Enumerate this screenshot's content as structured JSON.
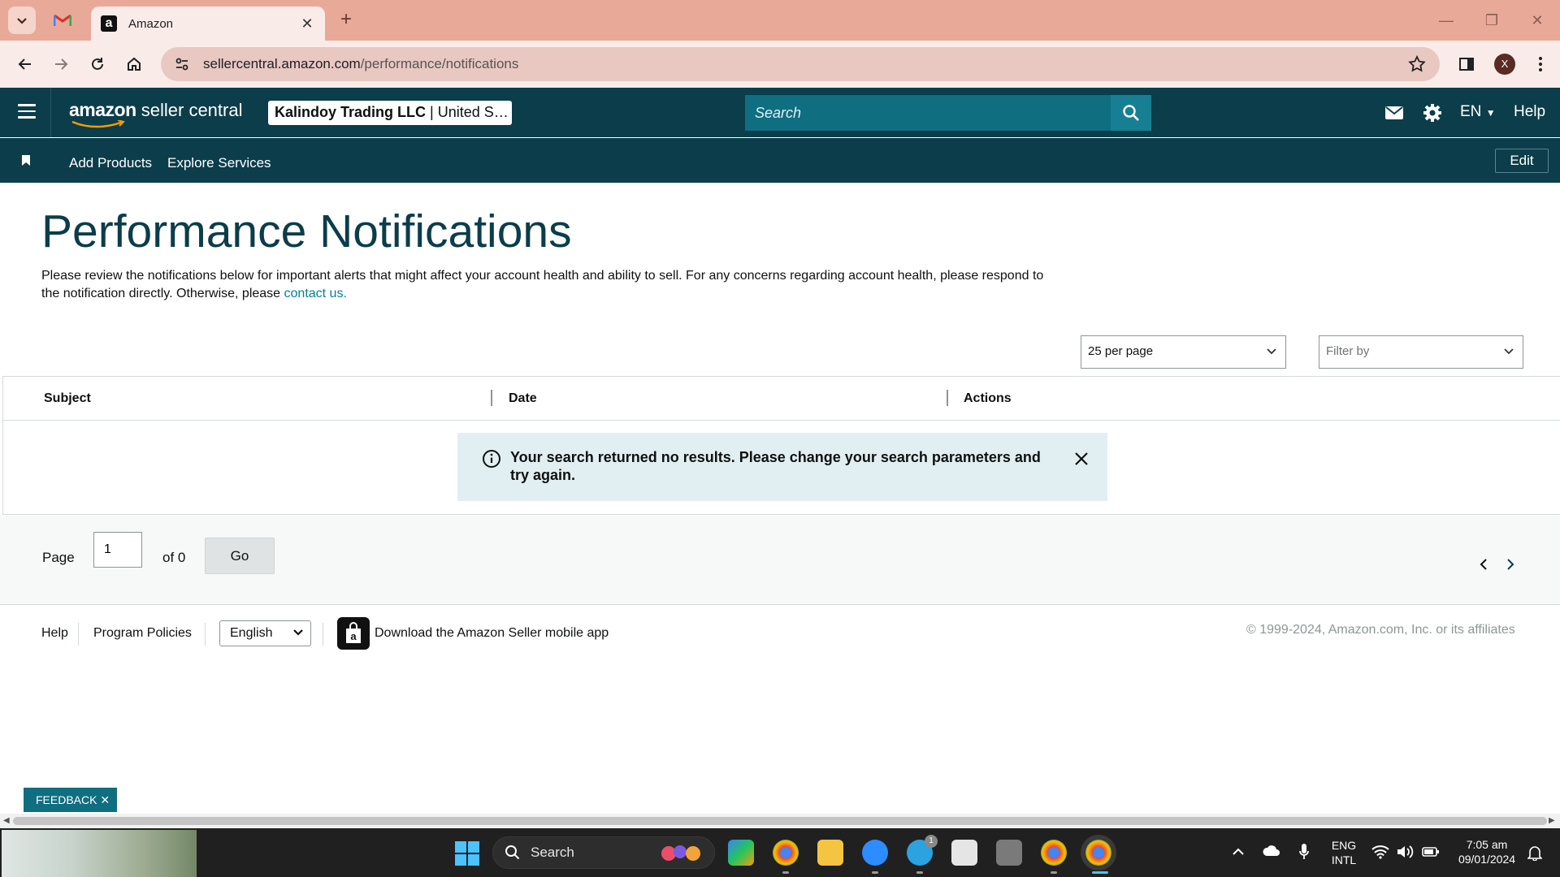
{
  "browser": {
    "tab_title": "Amazon",
    "favicon": "a",
    "url_domain": "sellercentral.amazon.com",
    "url_path": "/performance/notifications",
    "profile_initial": "X"
  },
  "header": {
    "logo_brand": "amazon",
    "logo_rest": " seller central",
    "account_name": "Kalindoy Trading LLC",
    "account_region": " | United S…",
    "search_placeholder": "Search",
    "language": "EN",
    "help": "Help"
  },
  "subnav": {
    "items": [
      {
        "label": "Add Products"
      },
      {
        "label": "Explore Services"
      }
    ],
    "edit_label": "Edit"
  },
  "page": {
    "title": "Performance Notifications",
    "description": "Please review the notifications below for important alerts that might affect your account health and ability to sell. For any concerns regarding account health, please respond to the notification directly. Otherwise, please ",
    "contact_link": "contact us."
  },
  "controls": {
    "per_page": "25 per page",
    "filter_placeholder": "Filter by"
  },
  "table": {
    "columns": [
      "Subject",
      "Date",
      "Actions"
    ]
  },
  "alert": {
    "message": "Your search returned no results. Please change your search parameters and try again."
  },
  "pager": {
    "page_label": "Page",
    "page_value": "1",
    "of_label": "of 0",
    "go_label": "Go"
  },
  "footer": {
    "help": "Help",
    "program_policies": "Program Policies",
    "language": "English",
    "app_text": "Download the Amazon Seller mobile app",
    "copyright": "© 1999-2024, Amazon.com, Inc. or its affiliates"
  },
  "feedback": {
    "label": "FEEDBACK ✕"
  },
  "taskbar": {
    "search": "Search",
    "lang_line1": "ENG",
    "lang_line2": "INTL",
    "time": "7:05 am",
    "date": "09/01/2024",
    "telegram_badge": "1"
  },
  "colors": {
    "header_bg": "#0b3d4a",
    "accent": "#008296",
    "search_bg": "#0f6e80",
    "alert_bg": "#e2eff2"
  }
}
